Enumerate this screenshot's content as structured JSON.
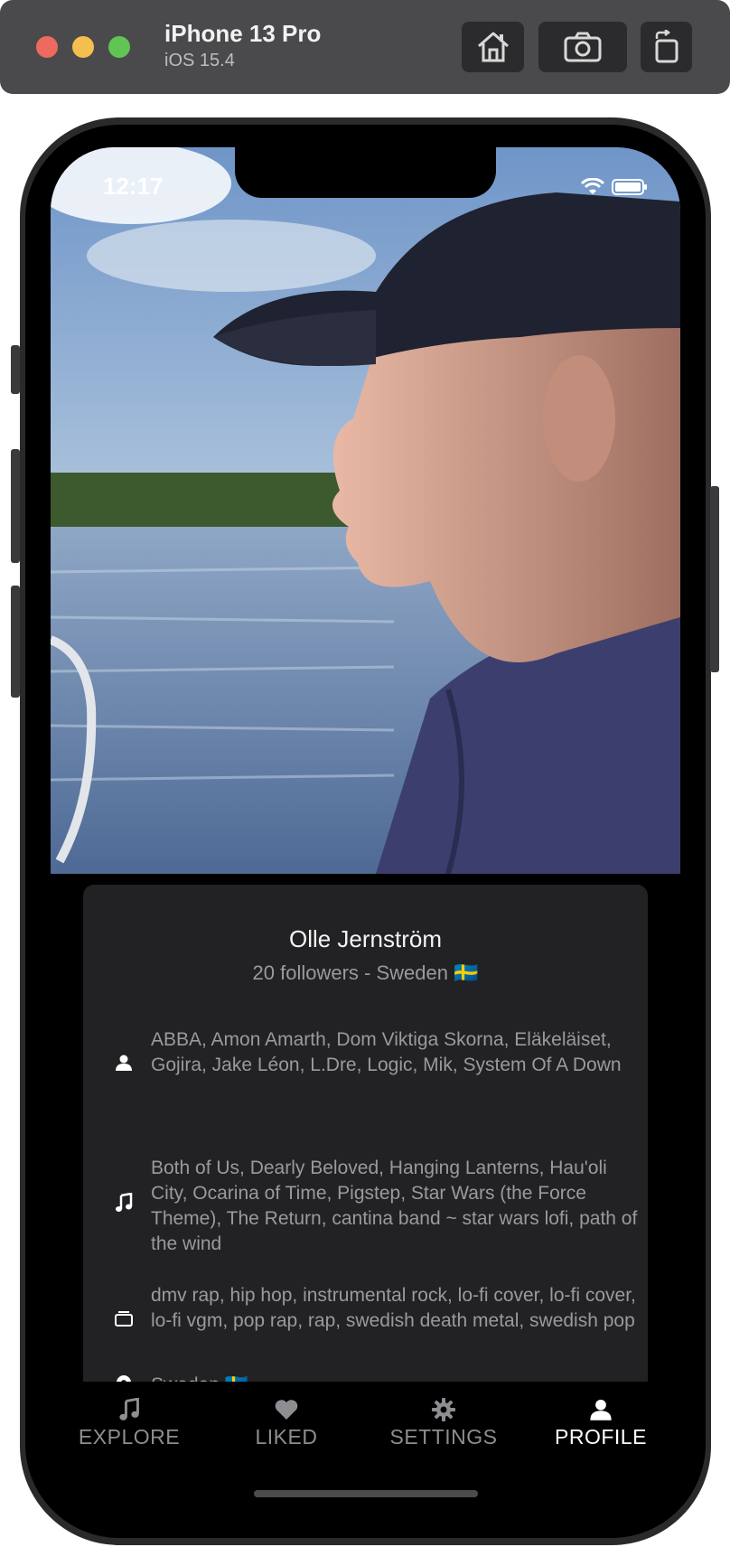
{
  "simulator": {
    "device_name": "iPhone 13 Pro",
    "os_version": "iOS 15.4",
    "buttons": {
      "home_icon": "home-icon",
      "screenshot_icon": "camera-icon",
      "rotate_icon": "rotate-icon"
    }
  },
  "status_bar": {
    "time": "12:17"
  },
  "profile": {
    "name": "Olle Jernström",
    "subline": "20 followers - Sweden 🇸🇪",
    "artists": "ABBA, Amon Amarth, Dom Viktiga Skorna, Eläkeläiset, Gojira, Jake Léon, L.Dre, Logic, Mik, System Of A Down",
    "songs": "Both of Us, Dearly Beloved, Hanging Lanterns, Hau'oli City, Ocarina of Time, Pigstep, Star Wars (the Force Theme), The Return, cantina band ~ star wars lofi, path of the wind",
    "genres": "dmv rap, hip hop, instrumental rock, lo-fi cover, lo-fi cover, lo-fi vgm, pop rap, rap, swedish death metal, swedish pop",
    "location": "Sweden 🇸🇪"
  },
  "tabbar": {
    "tabs": [
      {
        "label": "EXPLORE",
        "icon": "music-note-icon",
        "active": false
      },
      {
        "label": "LIKED",
        "icon": "heart-icon",
        "active": false
      },
      {
        "label": "SETTINGS",
        "icon": "gear-icon",
        "active": false
      },
      {
        "label": "PROFILE",
        "icon": "person-icon",
        "active": true
      }
    ]
  },
  "colors": {
    "card_bg": "#222224",
    "muted_text": "#9a9a9e",
    "active_tab": "#ffffff"
  }
}
